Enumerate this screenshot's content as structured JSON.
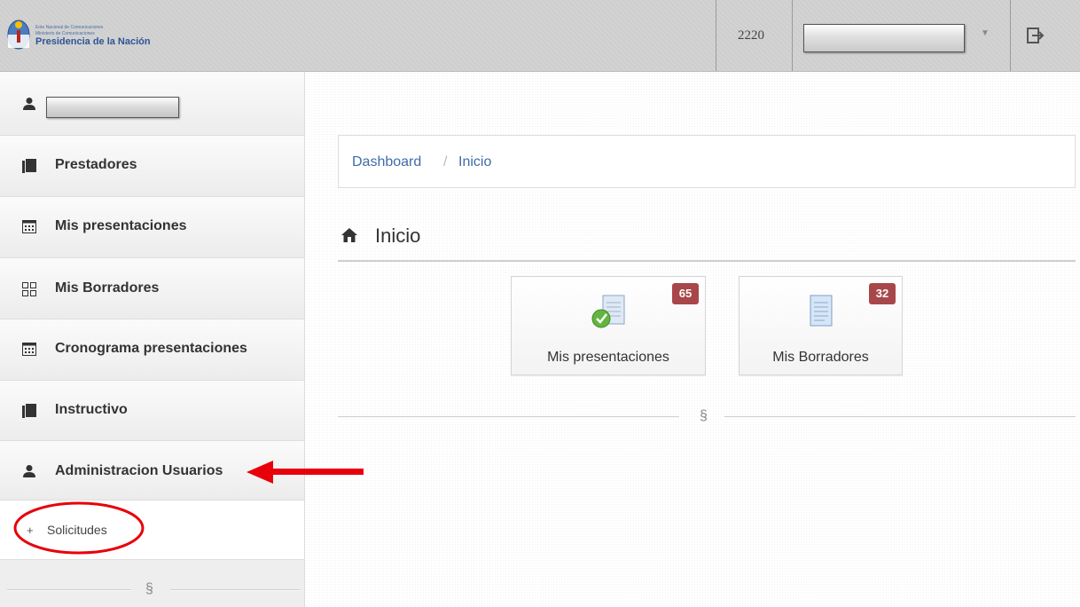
{
  "header": {
    "logo_lines": [
      "Ente Nacional de Comunicaciones",
      "Ministerio de Comunicaciones",
      "Presidencia de la Nación"
    ],
    "code": "2220",
    "user_select_value": "",
    "logout_icon": "logout-icon"
  },
  "sidebar": {
    "user_name": "",
    "items": [
      {
        "label": "Prestadores",
        "icon": "book-icon"
      },
      {
        "label": "Mis presentaciones",
        "icon": "calendar-icon"
      },
      {
        "label": "Mis Borradores",
        "icon": "grid-icon"
      },
      {
        "label": "Cronograma presentaciones",
        "icon": "calendar-icon"
      },
      {
        "label": "Instructivo",
        "icon": "book-icon"
      },
      {
        "label": "Administracion Usuarios",
        "icon": "user-icon"
      }
    ],
    "subitem": {
      "prefix": "+",
      "label": "Solicitudes"
    },
    "section_mark": "§"
  },
  "main": {
    "breadcrumb": [
      "Dashboard",
      "/",
      "Inicio"
    ],
    "title": "Inicio",
    "tiles": [
      {
        "label": "Mis presentaciones",
        "badge": "65",
        "icon": "document-check-icon"
      },
      {
        "label": "Mis Borradores",
        "badge": "32",
        "icon": "document-icon"
      }
    ],
    "section_mark": "§"
  },
  "colors": {
    "badge": "#a8474a",
    "link": "#3e6ca8",
    "annotation": "#e8000b"
  }
}
